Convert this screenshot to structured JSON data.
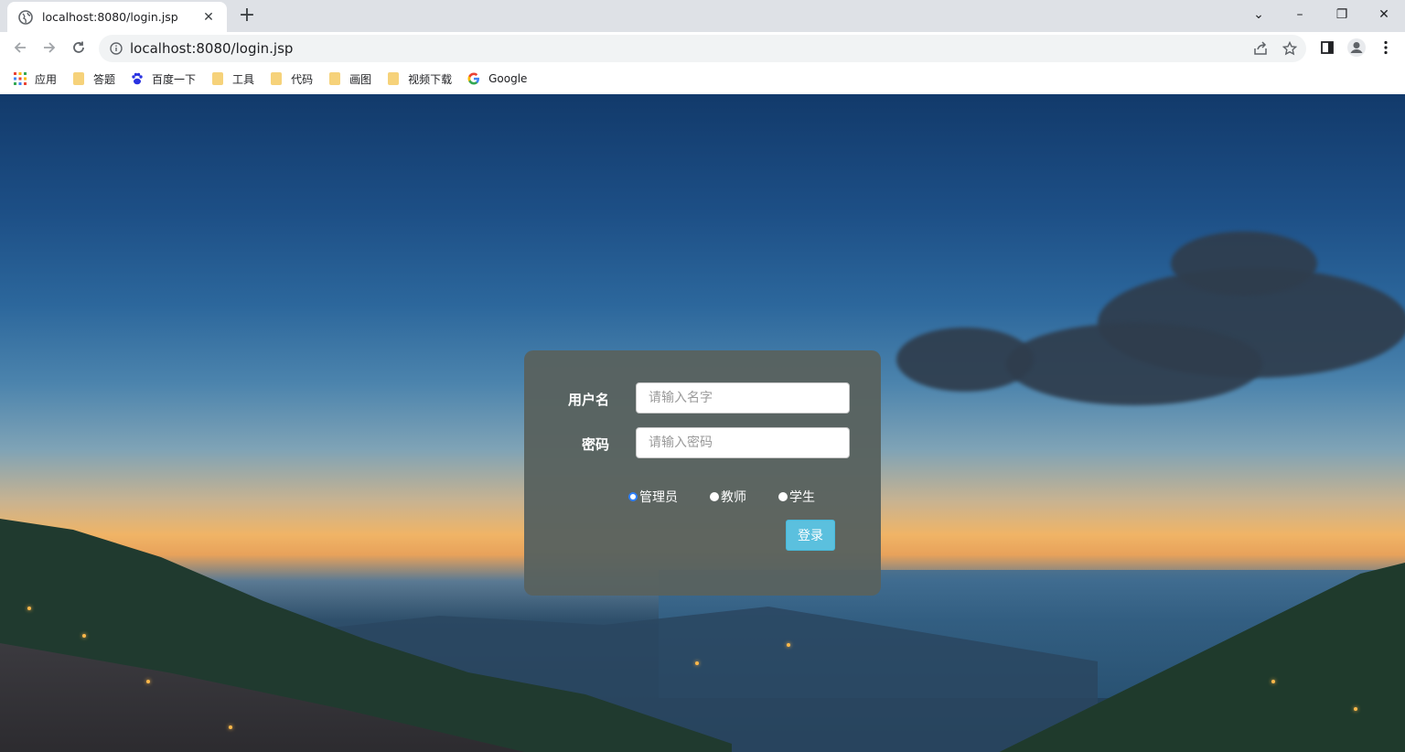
{
  "browser": {
    "tab": {
      "title": "localhost:8080/login.jsp",
      "close_glyph": "✕"
    },
    "new_tab_glyph": "+",
    "address": "localhost:8080/login.jsp",
    "window_controls": {
      "tabsearch_glyph": "⌄",
      "minimize_glyph": "–",
      "restore_glyph": "❐",
      "close_glyph": "✕"
    },
    "bookmarks": [
      {
        "label": "应用",
        "icon": "apps-grid-icon"
      },
      {
        "label": "答题",
        "icon": "folder-icon"
      },
      {
        "label": "百度一下",
        "icon": "baidu-paw-icon"
      },
      {
        "label": "工具",
        "icon": "folder-icon"
      },
      {
        "label": "代码",
        "icon": "folder-icon"
      },
      {
        "label": "画图",
        "icon": "folder-icon"
      },
      {
        "label": "视频下载",
        "icon": "folder-icon"
      },
      {
        "label": "Google",
        "icon": "google-g-icon"
      }
    ]
  },
  "login": {
    "username_label": "用户名",
    "username_placeholder": "请输入名字",
    "password_label": "密码",
    "password_placeholder": "请输入密码",
    "roles": [
      {
        "label": "管理员",
        "checked": true
      },
      {
        "label": "教师",
        "checked": false
      },
      {
        "label": "学生",
        "checked": false
      }
    ],
    "submit_label": "登录"
  },
  "colors": {
    "panel": "#58625f",
    "button": "#5bc0de",
    "radio_selected_ring": "#2d7ff9"
  }
}
